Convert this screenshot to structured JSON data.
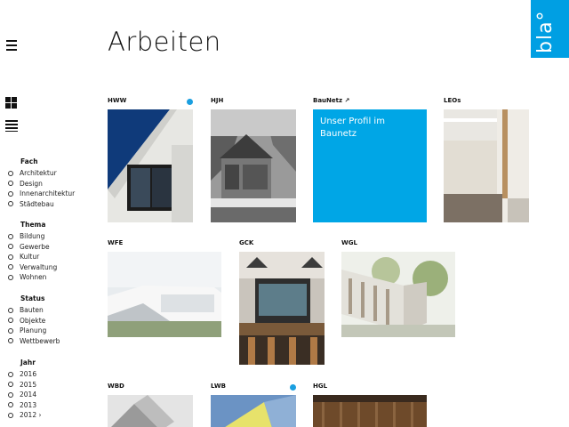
{
  "header": {
    "title": "Arbeiten",
    "logo_text": "bla°",
    "menu_icon": "hamburger-menu-icon",
    "accent_color": "#009fe3"
  },
  "view_toggles": {
    "grid_icon": "grid-view-icon",
    "list_icon": "list-view-icon"
  },
  "filters": [
    {
      "title": "Fach",
      "items": [
        "Architektur",
        "Design",
        "Innenarchitektur",
        "Städtebau"
      ]
    },
    {
      "title": "Thema",
      "items": [
        "Bildung",
        "Gewerbe",
        "Kultur",
        "Verwaltung",
        "Wohnen"
      ]
    },
    {
      "title": "Status",
      "items": [
        "Bauten",
        "Objekte",
        "Planung",
        "Wettbewerb"
      ]
    },
    {
      "title": "Jahr",
      "items": [
        "2016",
        "2015",
        "2014",
        "2013",
        "2012 ›"
      ]
    }
  ],
  "projects": {
    "hww": {
      "label": "HWW",
      "dot": true
    },
    "hjh": {
      "label": "HJH"
    },
    "baunetz": {
      "label": "BauNetz ↗",
      "text": "Unser Profil im Baunetz"
    },
    "leos": {
      "label": "LEOs"
    },
    "wfe": {
      "label": "WFE"
    },
    "gck": {
      "label": "GCK"
    },
    "wgl": {
      "label": "WGL"
    },
    "wbd": {
      "label": "WBD"
    },
    "lwb": {
      "label": "LWB",
      "dot": true
    },
    "hgl": {
      "label": "HGL"
    }
  }
}
